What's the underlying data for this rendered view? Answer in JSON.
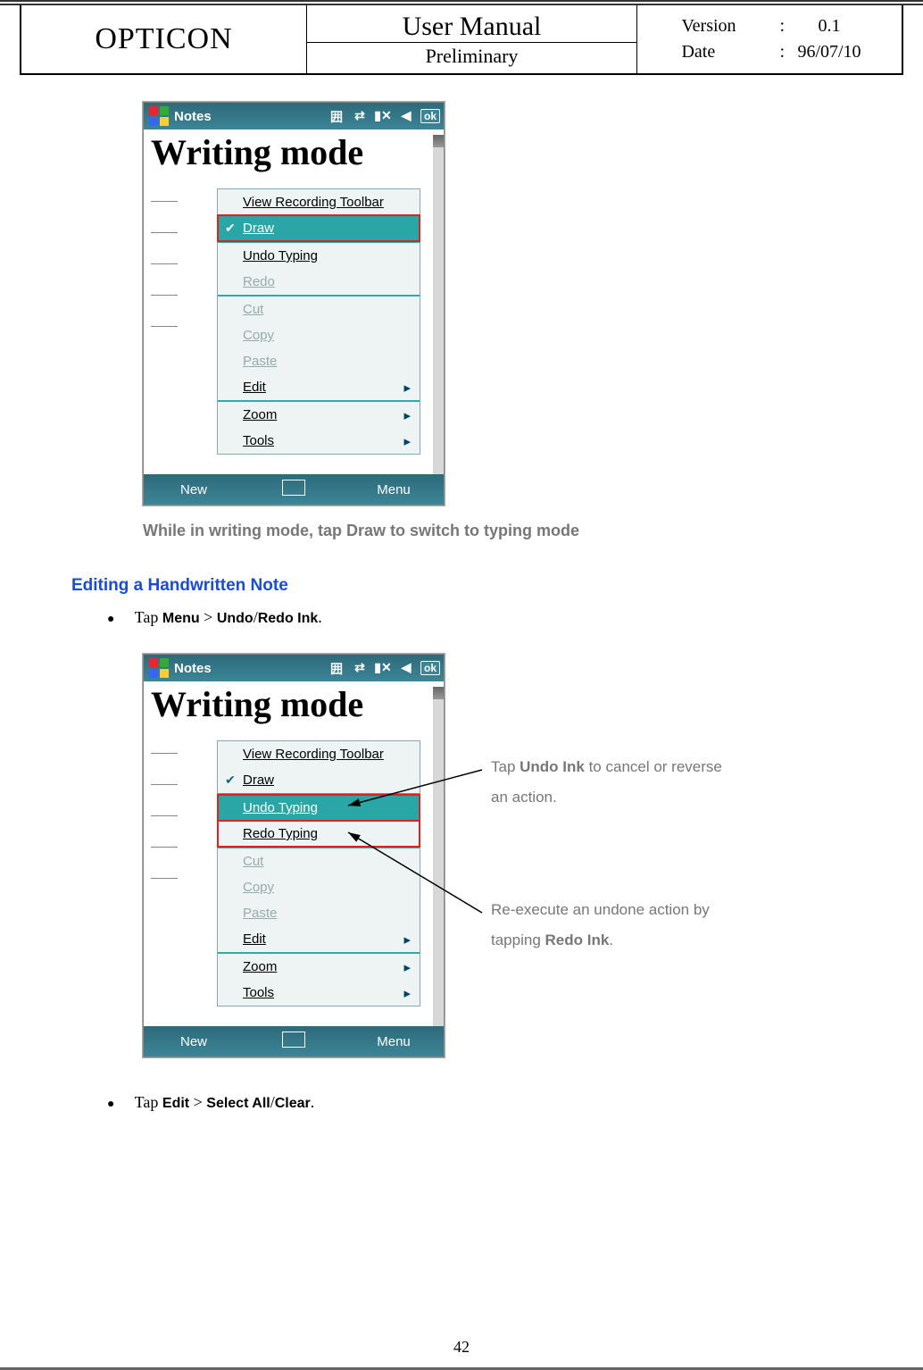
{
  "header": {
    "brand": "OPTICON",
    "title": "User Manual",
    "subtitle": "Preliminary",
    "version_label": "Version",
    "version_value": "0.1",
    "date_label": "Date",
    "date_value": "96/07/10",
    "colon": ":"
  },
  "fig1": {
    "app_title": "Notes",
    "ok": "ok",
    "handwriting": "Writing mode",
    "menu": {
      "view_recording_toolbar": "View Recording Toolbar",
      "draw": "Draw",
      "undo_typing": "Undo Typing",
      "redo": "Redo",
      "cut": "Cut",
      "copy": "Copy",
      "paste": "Paste",
      "edit": "Edit",
      "zoom": "Zoom",
      "tools": "Tools"
    },
    "soft_new": "New",
    "soft_menu": "Menu"
  },
  "caption1": "While in writing mode, tap Draw to switch to typing mode",
  "section_heading": "Editing a Handwritten Note",
  "bullet1_pre": "Tap ",
  "bullet1_b1": "Menu",
  "bullet1_mid": " > ",
  "bullet1_b2": "Undo",
  "bullet1_slash": "/",
  "bullet1_b3": "Redo Ink",
  "dot": ".",
  "fig2": {
    "app_title": "Notes",
    "ok": "ok",
    "handwriting": "Writing mode",
    "menu": {
      "view_recording_toolbar": "View Recording Toolbar",
      "draw": "Draw",
      "undo_typing": "Undo Typing",
      "redo_typing": "Redo Typing",
      "cut": "Cut",
      "copy": "Copy",
      "paste": "Paste",
      "edit": "Edit",
      "zoom": "Zoom",
      "tools": "Tools"
    },
    "soft_new": "New",
    "soft_menu": "Menu"
  },
  "annot1_pre": "Tap ",
  "annot1_b": "Undo Ink",
  "annot1_post": " to cancel or reverse an action.",
  "annot2_pre": "Re-execute an undone action by tapping ",
  "annot2_b": "Redo Ink",
  "bullet2_pre": "Tap ",
  "bullet2_b1": "Edit",
  "bullet2_mid": " > ",
  "bullet2_b2": "Select All",
  "bullet2_slash": "/",
  "bullet2_b3": "Clear",
  "page_number": "42"
}
